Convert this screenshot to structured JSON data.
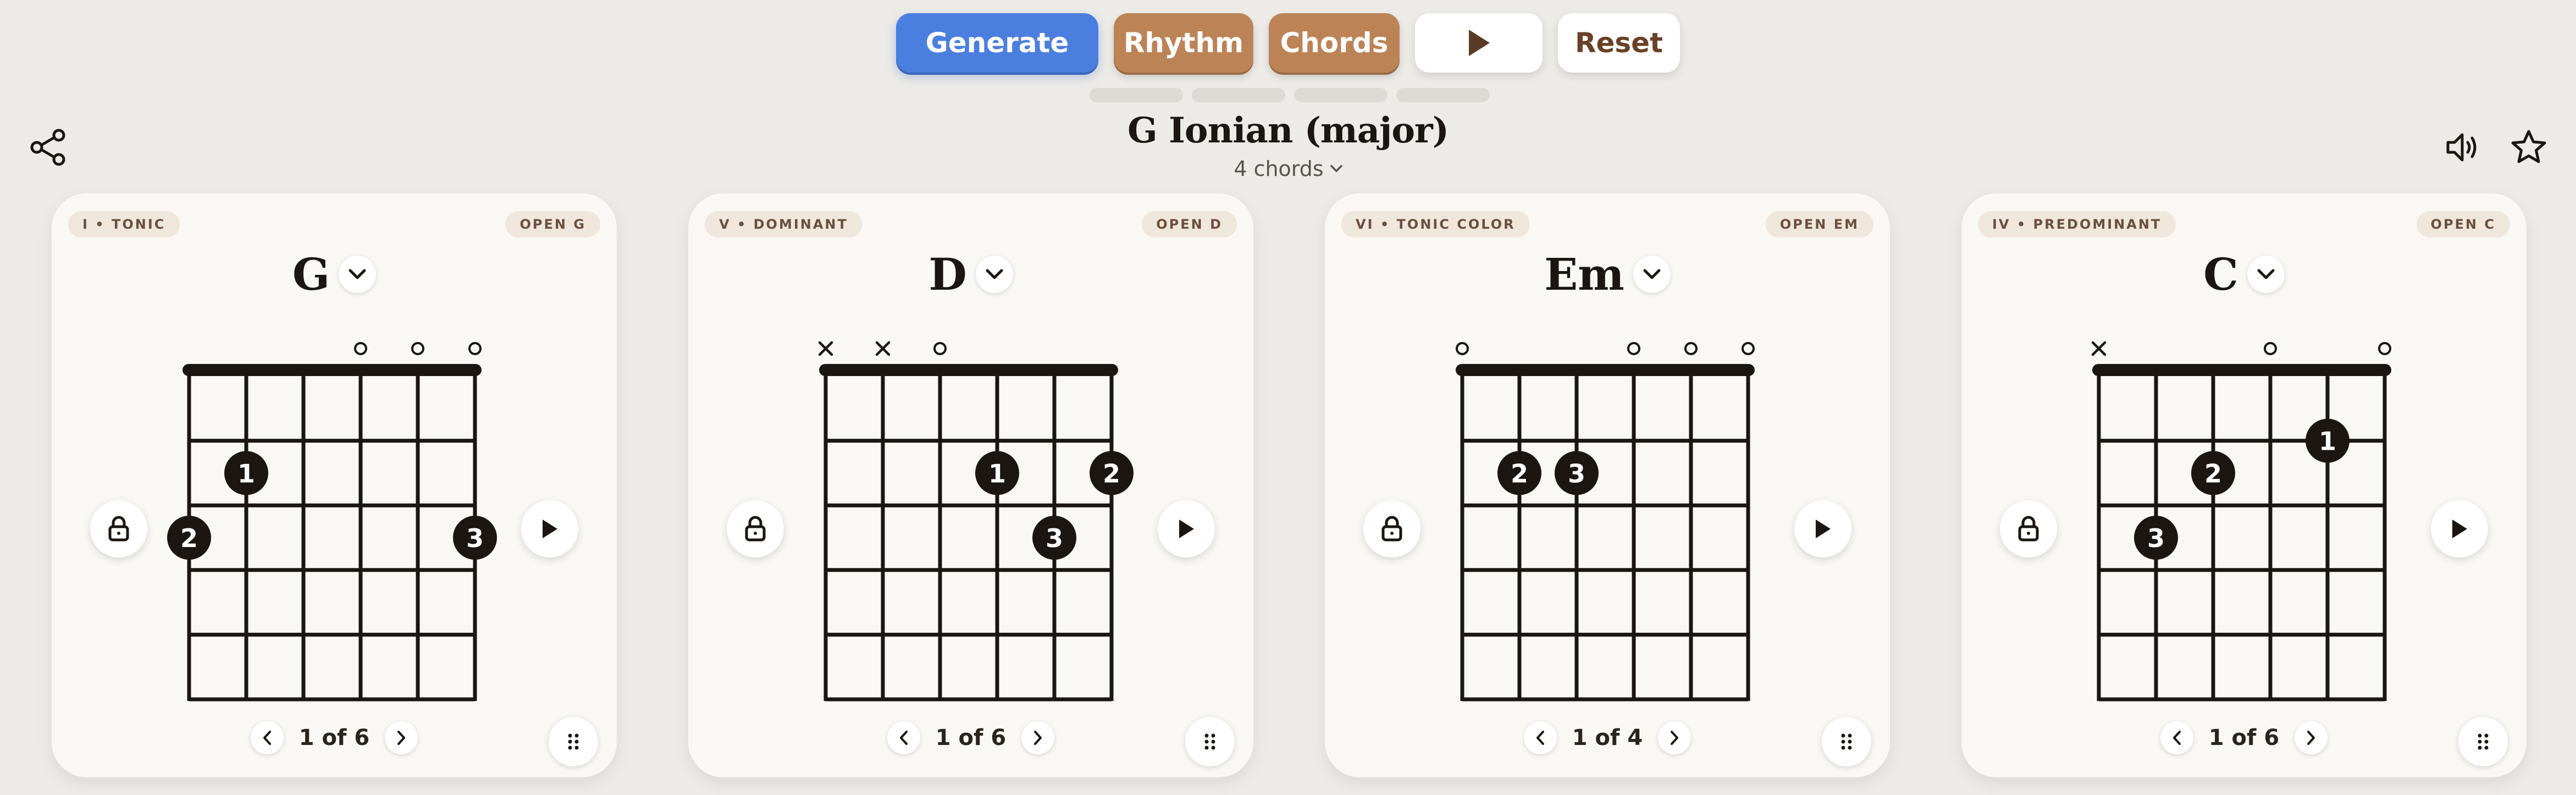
{
  "toolbar": {
    "generate": "Generate",
    "rhythm": "Rhythm",
    "chords": "Chords",
    "reset": "Reset",
    "play_icon": "play-icon"
  },
  "header": {
    "title": "G Ionian (major)",
    "chord_count": "4 chords",
    "share_icon": "share-icon",
    "volume_icon": "volume-icon",
    "star_icon": "star-icon"
  },
  "colors": {
    "accent_blue": "#4b7fdf",
    "brown": "#bc8456",
    "dot": "#1b1612"
  },
  "cards": [
    {
      "function": "I • TONIC",
      "voicing": "OPEN G",
      "name": "G",
      "pager": "1 of 6",
      "markers": [
        "",
        "",
        "",
        "o",
        "o",
        "o"
      ],
      "dots": [
        {
          "string": 1,
          "fret": 2,
          "finger": "2"
        },
        {
          "string": 2,
          "fret": 1,
          "finger": "1"
        },
        {
          "string": 6,
          "fret": 2,
          "finger": "3"
        }
      ]
    },
    {
      "function": "V • DOMINANT",
      "voicing": "OPEN D",
      "name": "D",
      "pager": "1 of 6",
      "markers": [
        "x",
        "x",
        "o",
        "",
        "",
        ""
      ],
      "dots": [
        {
          "string": 4,
          "fret": 1,
          "finger": "1"
        },
        {
          "string": 6,
          "fret": 1,
          "finger": "2"
        },
        {
          "string": 5,
          "fret": 2,
          "finger": "3"
        }
      ]
    },
    {
      "function": "VI • TONIC COLOR",
      "voicing": "OPEN EM",
      "name": "Em",
      "pager": "1 of 4",
      "markers": [
        "o",
        "",
        "",
        "o",
        "o",
        "o"
      ],
      "dots": [
        {
          "string": 2,
          "fret": 1,
          "finger": "2"
        },
        {
          "string": 3,
          "fret": 1,
          "finger": "3"
        }
      ]
    },
    {
      "function": "IV • PREDOMINANT",
      "voicing": "OPEN C",
      "name": "C",
      "pager": "1 of 6",
      "markers": [
        "x",
        "",
        "",
        "o",
        "",
        "o"
      ],
      "dots": [
        {
          "string": 5,
          "fret": 0.5,
          "finger": "1"
        },
        {
          "string": 3,
          "fret": 1,
          "finger": "2"
        },
        {
          "string": 2,
          "fret": 2,
          "finger": "3"
        }
      ]
    }
  ]
}
